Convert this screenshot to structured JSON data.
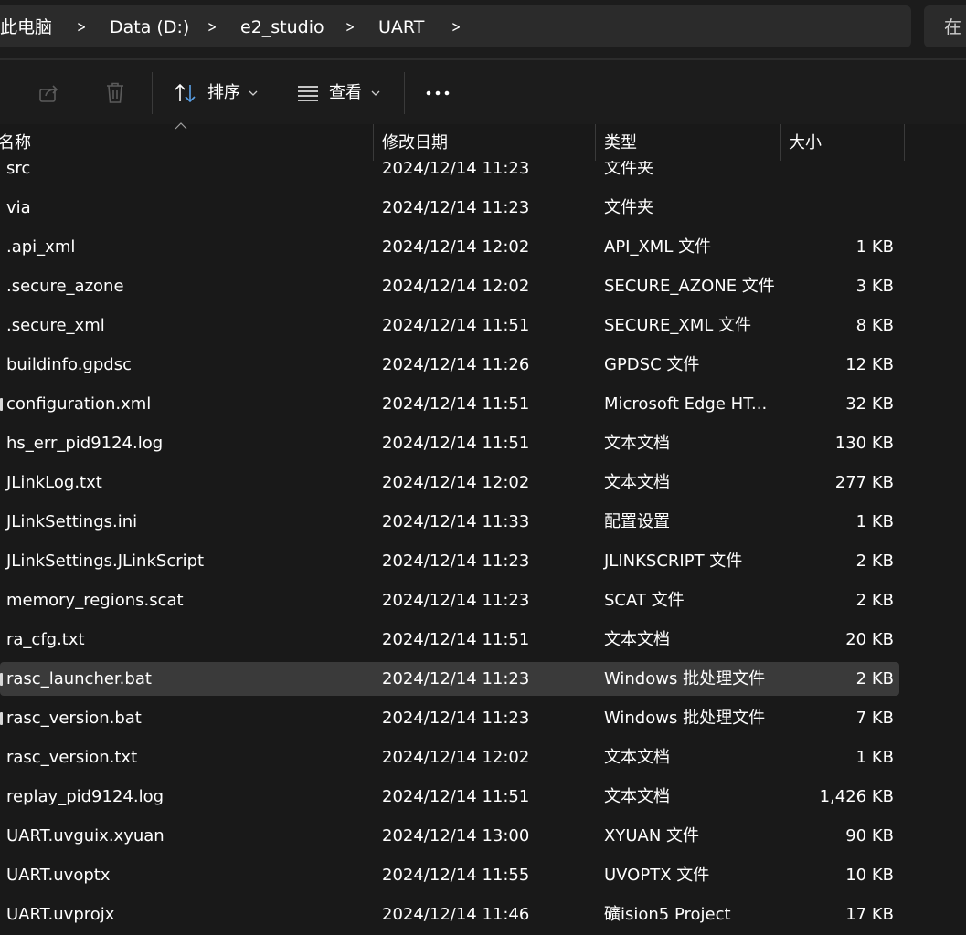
{
  "breadcrumb": {
    "items": [
      "此电脑",
      "Data (D:)",
      "e2_studio",
      "UART"
    ],
    "separator": ">"
  },
  "search": {
    "placeholder": "在"
  },
  "toolbar": {
    "share_icon": "share-icon",
    "delete_icon": "trash-icon",
    "sort_label": "排序",
    "view_label": "查看",
    "more_icon": "more-icon"
  },
  "columns": {
    "name": "名称",
    "date": "修改日期",
    "type": "类型",
    "size": "大小"
  },
  "files": [
    {
      "name": "src",
      "date": "2024/12/14 11:23",
      "type": "文件夹",
      "size": ""
    },
    {
      "name": "via",
      "date": "2024/12/14 11:23",
      "type": "文件夹",
      "size": ""
    },
    {
      "name": ".api_xml",
      "date": "2024/12/14 12:02",
      "type": "API_XML 文件",
      "size": "1 KB"
    },
    {
      "name": ".secure_azone",
      "date": "2024/12/14 12:02",
      "type": "SECURE_AZONE 文件",
      "size": "3 KB"
    },
    {
      "name": ".secure_xml",
      "date": "2024/12/14 11:51",
      "type": "SECURE_XML 文件",
      "size": "8 KB"
    },
    {
      "name": "buildinfo.gpdsc",
      "date": "2024/12/14 11:26",
      "type": "GPDSC 文件",
      "size": "12 KB"
    },
    {
      "name": "configuration.xml",
      "date": "2024/12/14 11:51",
      "type": "Microsoft Edge HT...",
      "size": "32 KB"
    },
    {
      "name": "hs_err_pid9124.log",
      "date": "2024/12/14 11:51",
      "type": "文本文档",
      "size": "130 KB"
    },
    {
      "name": "JLinkLog.txt",
      "date": "2024/12/14 12:02",
      "type": "文本文档",
      "size": "277 KB"
    },
    {
      "name": "JLinkSettings.ini",
      "date": "2024/12/14 11:33",
      "type": "配置设置",
      "size": "1 KB"
    },
    {
      "name": "JLinkSettings.JLinkScript",
      "date": "2024/12/14 11:23",
      "type": "JLINKSCRIPT 文件",
      "size": "2 KB"
    },
    {
      "name": "memory_regions.scat",
      "date": "2024/12/14 11:23",
      "type": "SCAT 文件",
      "size": "2 KB"
    },
    {
      "name": "ra_cfg.txt",
      "date": "2024/12/14 11:51",
      "type": "文本文档",
      "size": "20 KB"
    },
    {
      "name": "rasc_launcher.bat",
      "date": "2024/12/14 11:23",
      "type": "Windows 批处理文件",
      "size": "2 KB",
      "selected": true
    },
    {
      "name": "rasc_version.bat",
      "date": "2024/12/14 11:23",
      "type": "Windows 批处理文件",
      "size": "7 KB"
    },
    {
      "name": "rasc_version.txt",
      "date": "2024/12/14 12:02",
      "type": "文本文档",
      "size": "1 KB"
    },
    {
      "name": "replay_pid9124.log",
      "date": "2024/12/14 11:51",
      "type": "文本文档",
      "size": "1,426 KB"
    },
    {
      "name": "UART.uvguix.xyuan",
      "date": "2024/12/14 13:00",
      "type": "XYUAN 文件",
      "size": "90 KB"
    },
    {
      "name": "UART.uvoptx",
      "date": "2024/12/14 11:55",
      "type": "UVOPTX 文件",
      "size": "10 KB"
    },
    {
      "name": "UART.uvprojx",
      "date": "2024/12/14 11:46",
      "type": "礦ision5 Project",
      "size": "17 KB"
    }
  ],
  "colors": {
    "background": "#191919",
    "toolbar": "#1c1c1c",
    "selection": "#3a3a3a",
    "text": "#ffffff",
    "accent_icon": "#5aa0e6"
  }
}
